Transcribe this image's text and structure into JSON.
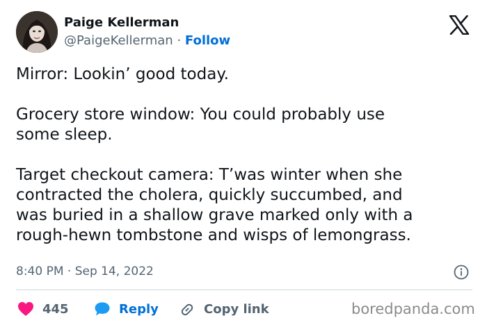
{
  "author": {
    "name": "Paige Kellerman",
    "handle": "@PaigeKellerman",
    "separator": "·",
    "follow_label": "Follow",
    "avatar": "profile-photo"
  },
  "platform": {
    "logo": "x-logo-icon"
  },
  "tweet": {
    "lines_1": [
      "Mirror: Lookin’ good today."
    ],
    "lines_2": [
      "Grocery store window: You could probably use",
      "some sleep."
    ],
    "lines_3": [
      "Target checkout camera: T’was winter when she",
      "contracted the cholera, quickly succumbed, and",
      "was buried in a shallow grave marked only with a",
      "rough-hewn tombstone and wisps of lemongrass."
    ]
  },
  "meta": {
    "timestamp": "8:40 PM · Sep 14, 2022",
    "info_icon": "info-icon"
  },
  "actions": {
    "like_count": "445",
    "reply_label": "Reply",
    "copy_link_label": "Copy link"
  },
  "watermark": "boredpanda.com",
  "colors": {
    "like": "#f91880",
    "link_blue": "#006fd6",
    "secondary_text": "#536471",
    "divider": "#cfd9de"
  }
}
